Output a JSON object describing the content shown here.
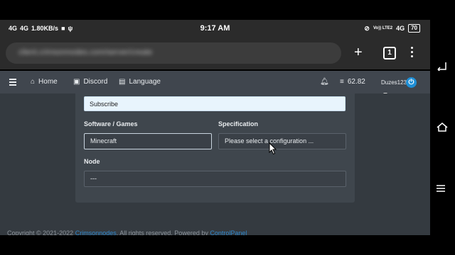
{
  "status_bar": {
    "network_1": "4G",
    "network_2": "4G",
    "speed": "1.80KB/s",
    "time": "9:17 AM",
    "volte": "Vo)) LTE2",
    "network_3": "4G",
    "battery": "70"
  },
  "browser": {
    "url": "client.crimsonnodes.com/server/create",
    "tab_count": "1"
  },
  "nav": {
    "home": "Home",
    "discord": "Discord",
    "language": "Language",
    "credits": "62.82",
    "username": "Duzes123"
  },
  "form": {
    "subscribe_label": "Subscribe",
    "software_label": "Software / Games",
    "software_value": "Minecraft",
    "spec_label": "Specification",
    "spec_placeholder": "Please select a configuration ...",
    "node_label": "Node",
    "node_value": "---"
  },
  "footer": {
    "prefix": "Copyright © 2021-2022",
    "brand": "Crimsonnodes",
    "middle": "All rights reserved. Powered by",
    "powered": "ControlPanel"
  }
}
